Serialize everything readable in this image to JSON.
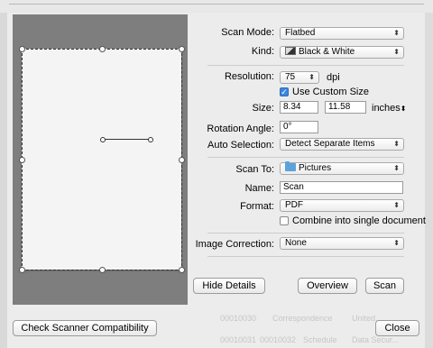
{
  "scan_mode": {
    "label": "Scan Mode:",
    "value": "Flatbed"
  },
  "kind": {
    "label": "Kind:",
    "value": "Black & White",
    "icon": "bw-image-icon"
  },
  "resolution": {
    "label": "Resolution:",
    "value": "75",
    "unit": "dpi"
  },
  "custom_size": {
    "label": "Use Custom Size",
    "checked": true
  },
  "size": {
    "label": "Size:",
    "width": "8.34",
    "height": "11.58",
    "unit": "inches"
  },
  "rotation": {
    "label": "Rotation Angle:",
    "value": "0°"
  },
  "auto_selection": {
    "label": "Auto Selection:",
    "value": "Detect Separate Items"
  },
  "scan_to": {
    "label": "Scan To:",
    "value": "Pictures",
    "icon": "folder-icon"
  },
  "name": {
    "label": "Name:",
    "value": "Scan"
  },
  "format": {
    "label": "Format:",
    "value": "PDF"
  },
  "combine": {
    "label": "Combine into single document",
    "checked": false
  },
  "image_correction": {
    "label": "Image Correction:",
    "value": "None"
  },
  "buttons": {
    "hide_details": "Hide Details",
    "overview": "Overview",
    "scan": "Scan",
    "check_compat": "Check Scanner Compatibility",
    "close": "Close"
  },
  "background_list": [
    {
      "c1": "00010030",
      "c2": "Correspondence",
      "c3": "United..."
    },
    {
      "c1": "00010031",
      "c2": "00010032",
      "c3": "Schedule",
      "c4": "Data Secur..."
    }
  ]
}
